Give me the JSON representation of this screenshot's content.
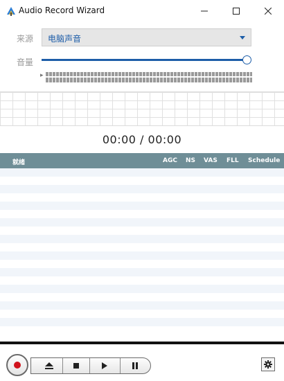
{
  "window": {
    "title": "Audio Record Wizard",
    "icon": "app-logo-icon",
    "minimize": "–",
    "maximize": "☐",
    "close": "✕"
  },
  "source": {
    "label": "来源",
    "value": "电脑声音"
  },
  "volume": {
    "label": "音量",
    "level": 1.0
  },
  "time": {
    "display": "00:00 / 00:00"
  },
  "list": {
    "columns": [
      "就绪",
      "AGC",
      "NS",
      "VAS",
      "FLL",
      "Schedule"
    ]
  },
  "controls": {
    "record_icon": "record-icon",
    "eject_icon": "eject-icon",
    "stop_icon": "stop-icon",
    "play_icon": "play-icon",
    "pause_icon": "pause-icon",
    "settings_icon": "gear-icon"
  },
  "colors": {
    "accent": "#1d5da8",
    "header": "#6f8e97",
    "record": "#d0121b"
  }
}
